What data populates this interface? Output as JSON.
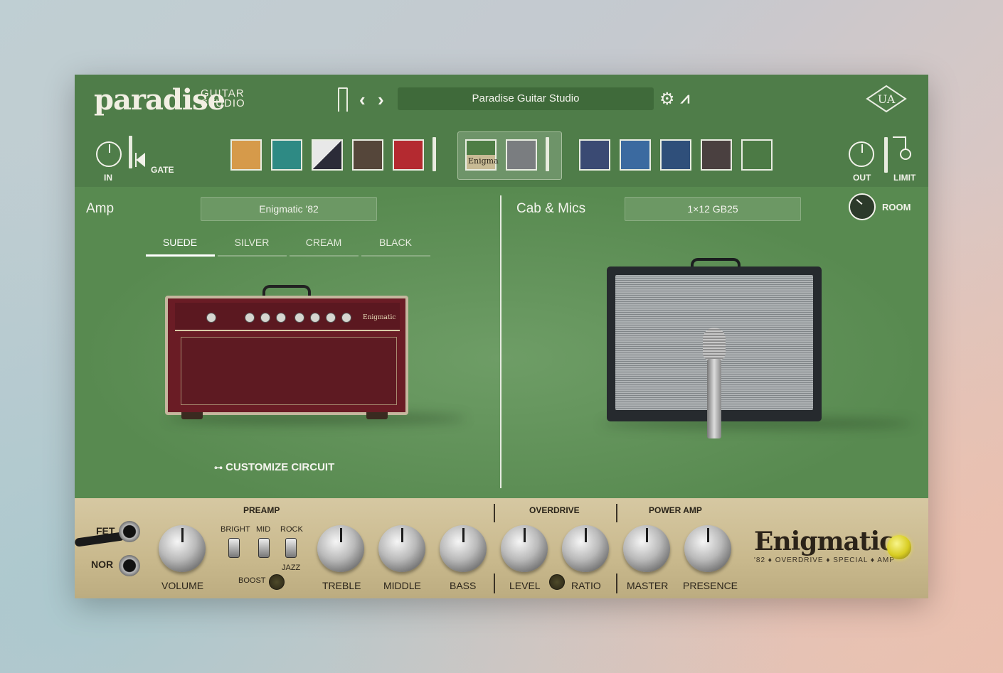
{
  "header": {
    "logo_main": "paradise",
    "logo_sub": "GUITAR STUDIO",
    "preset_name": "Paradise Guitar Studio",
    "prev_label": "‹",
    "next_label": "›"
  },
  "chain": {
    "in_label": "IN",
    "gate_label": "GATE",
    "out_label": "OUT",
    "limit_label": "LIMIT",
    "amp_thumb_label": "Enigma"
  },
  "amp": {
    "title": "Amp",
    "model": "Enigmatic '82",
    "tabs": [
      "SUEDE",
      "SILVER",
      "CREAM",
      "BLACK"
    ],
    "active_tab": "SUEDE",
    "customize": "CUSTOMIZE CIRCUIT",
    "faceplate_logo": "Enigmatic"
  },
  "cab": {
    "title": "Cab & Mics",
    "model": "1×12 GB25",
    "room_label": "ROOM"
  },
  "panel": {
    "fet": "FET",
    "nor": "NOR",
    "preamp": "PREAMP",
    "overdrive": "OVERDRIVE",
    "power_amp": "POWER AMP",
    "bright": "BRIGHT",
    "mid": "MID",
    "rock": "ROCK",
    "jazz": "JAZZ",
    "boost": "BOOST",
    "volume": "VOLUME",
    "treble": "TREBLE",
    "middle": "MIDDLE",
    "bass": "BASS",
    "level": "LEVEL",
    "ratio": "RATIO",
    "master": "MASTER",
    "presence": "PRESENCE",
    "brand": "Enigmatic",
    "brand_sub": "'82 ♦ OVERDRIVE ♦ SPECIAL ♦ AMP"
  },
  "colors": {
    "window_green": "#5a8a52",
    "header_green": "#4f7d49",
    "panel_tan": "#cfc098",
    "amp_tolex": "#6a1c25",
    "lamp_yellow": "#e6dd3a"
  }
}
